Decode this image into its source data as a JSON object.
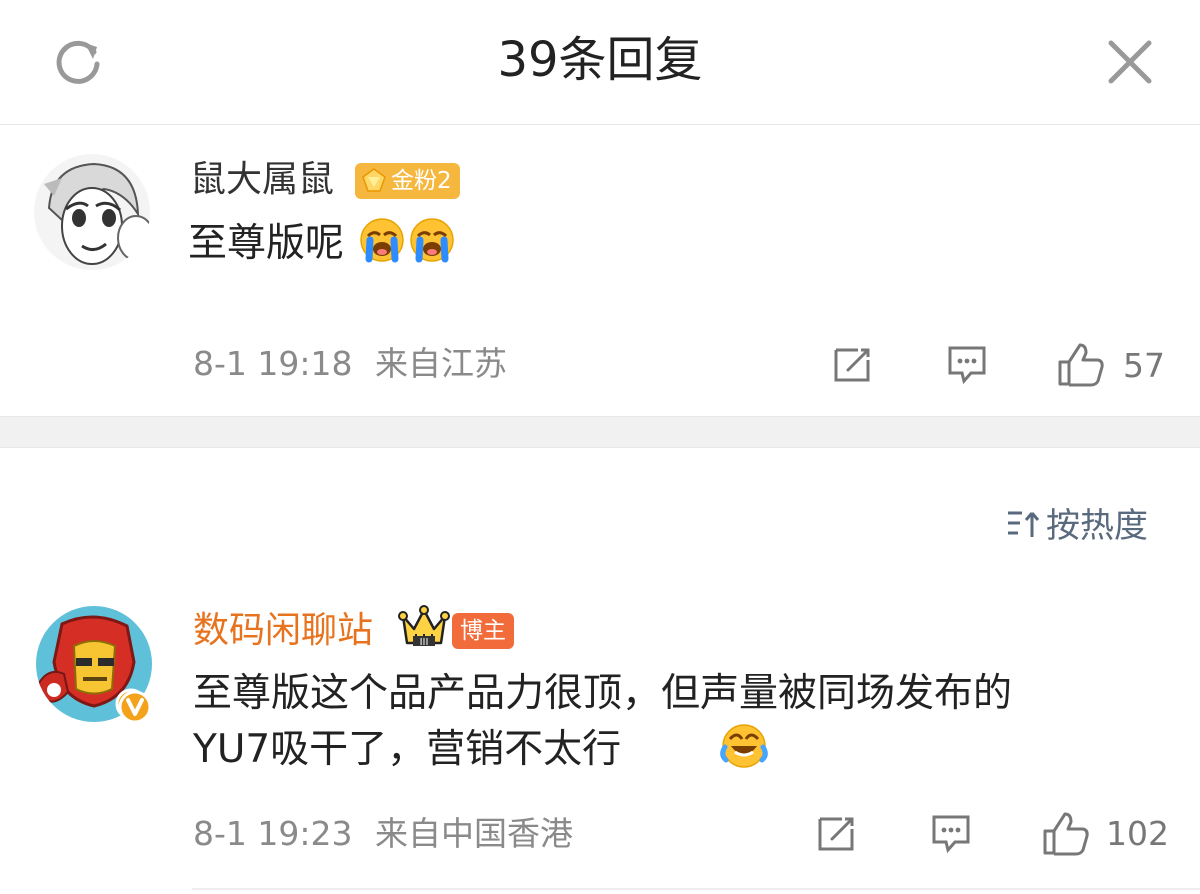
{
  "header": {
    "title": "39条回复",
    "refresh_icon": "refresh-icon",
    "close_icon": "close-icon"
  },
  "comments": [
    {
      "username": "鼠大属鼠",
      "username_color": "#333333",
      "badge": "金粉2",
      "badge_color": "#f5b73d",
      "text": "至尊版呢",
      "emojis": [
        "crying-emoji",
        "crying-emoji"
      ],
      "time": "8-1 19:18",
      "location": "来自江苏",
      "likes": "57"
    },
    {
      "username": "数码闲聊站",
      "username_color": "#e8731f",
      "badge": "博主",
      "badge_color": "#f26b3a",
      "text_line1": "至尊版这个品产品力很顶，但声量被同场发布的",
      "text_line2": "YU7吸干了，营销不太行",
      "emojis": [
        "laughing-crying-emoji"
      ],
      "time": "8-1 19:23",
      "location": "来自中国香港",
      "likes": "102"
    }
  ],
  "sort": {
    "label": "按热度"
  }
}
